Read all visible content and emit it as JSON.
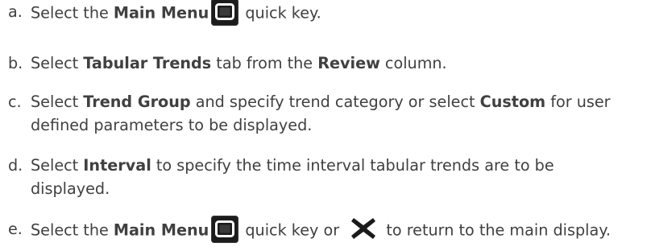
{
  "steps": [
    {
      "marker": "a.",
      "parts": {
        "t1": "Select the ",
        "b1": "Main Menu",
        "icon": "main-menu-key-icon",
        "t2": " quick key."
      }
    },
    {
      "marker": "b.",
      "parts": {
        "t1": "Select ",
        "b1": "Tabular Trends",
        "t2": " tab from the ",
        "b2": "Review",
        "t3": " column."
      }
    },
    {
      "marker": "c.",
      "parts": {
        "t1": "Select ",
        "b1": "Trend Group",
        "t2": " and specify trend category or select ",
        "b2": "Custom",
        "t3": " for user",
        "line2": "defined parameters to be displayed."
      }
    },
    {
      "marker": "d.",
      "parts": {
        "t1": "Select ",
        "b1": "Interval",
        "t2": " to specify the time interval tabular trends are to be",
        "line2": "displayed."
      }
    },
    {
      "marker": "e.",
      "parts": {
        "t1": "Select the ",
        "b1": "Main Menu",
        "icon": "main-menu-key-icon",
        "t2": " quick key or ",
        "icon2": "close-x-icon",
        "t3": " to return to the main display."
      }
    }
  ],
  "colors": {
    "text": "#404040",
    "key_background": "#1c1c1c",
    "key_glyph": "#ffffff",
    "close_x": "#1a1a1a"
  }
}
